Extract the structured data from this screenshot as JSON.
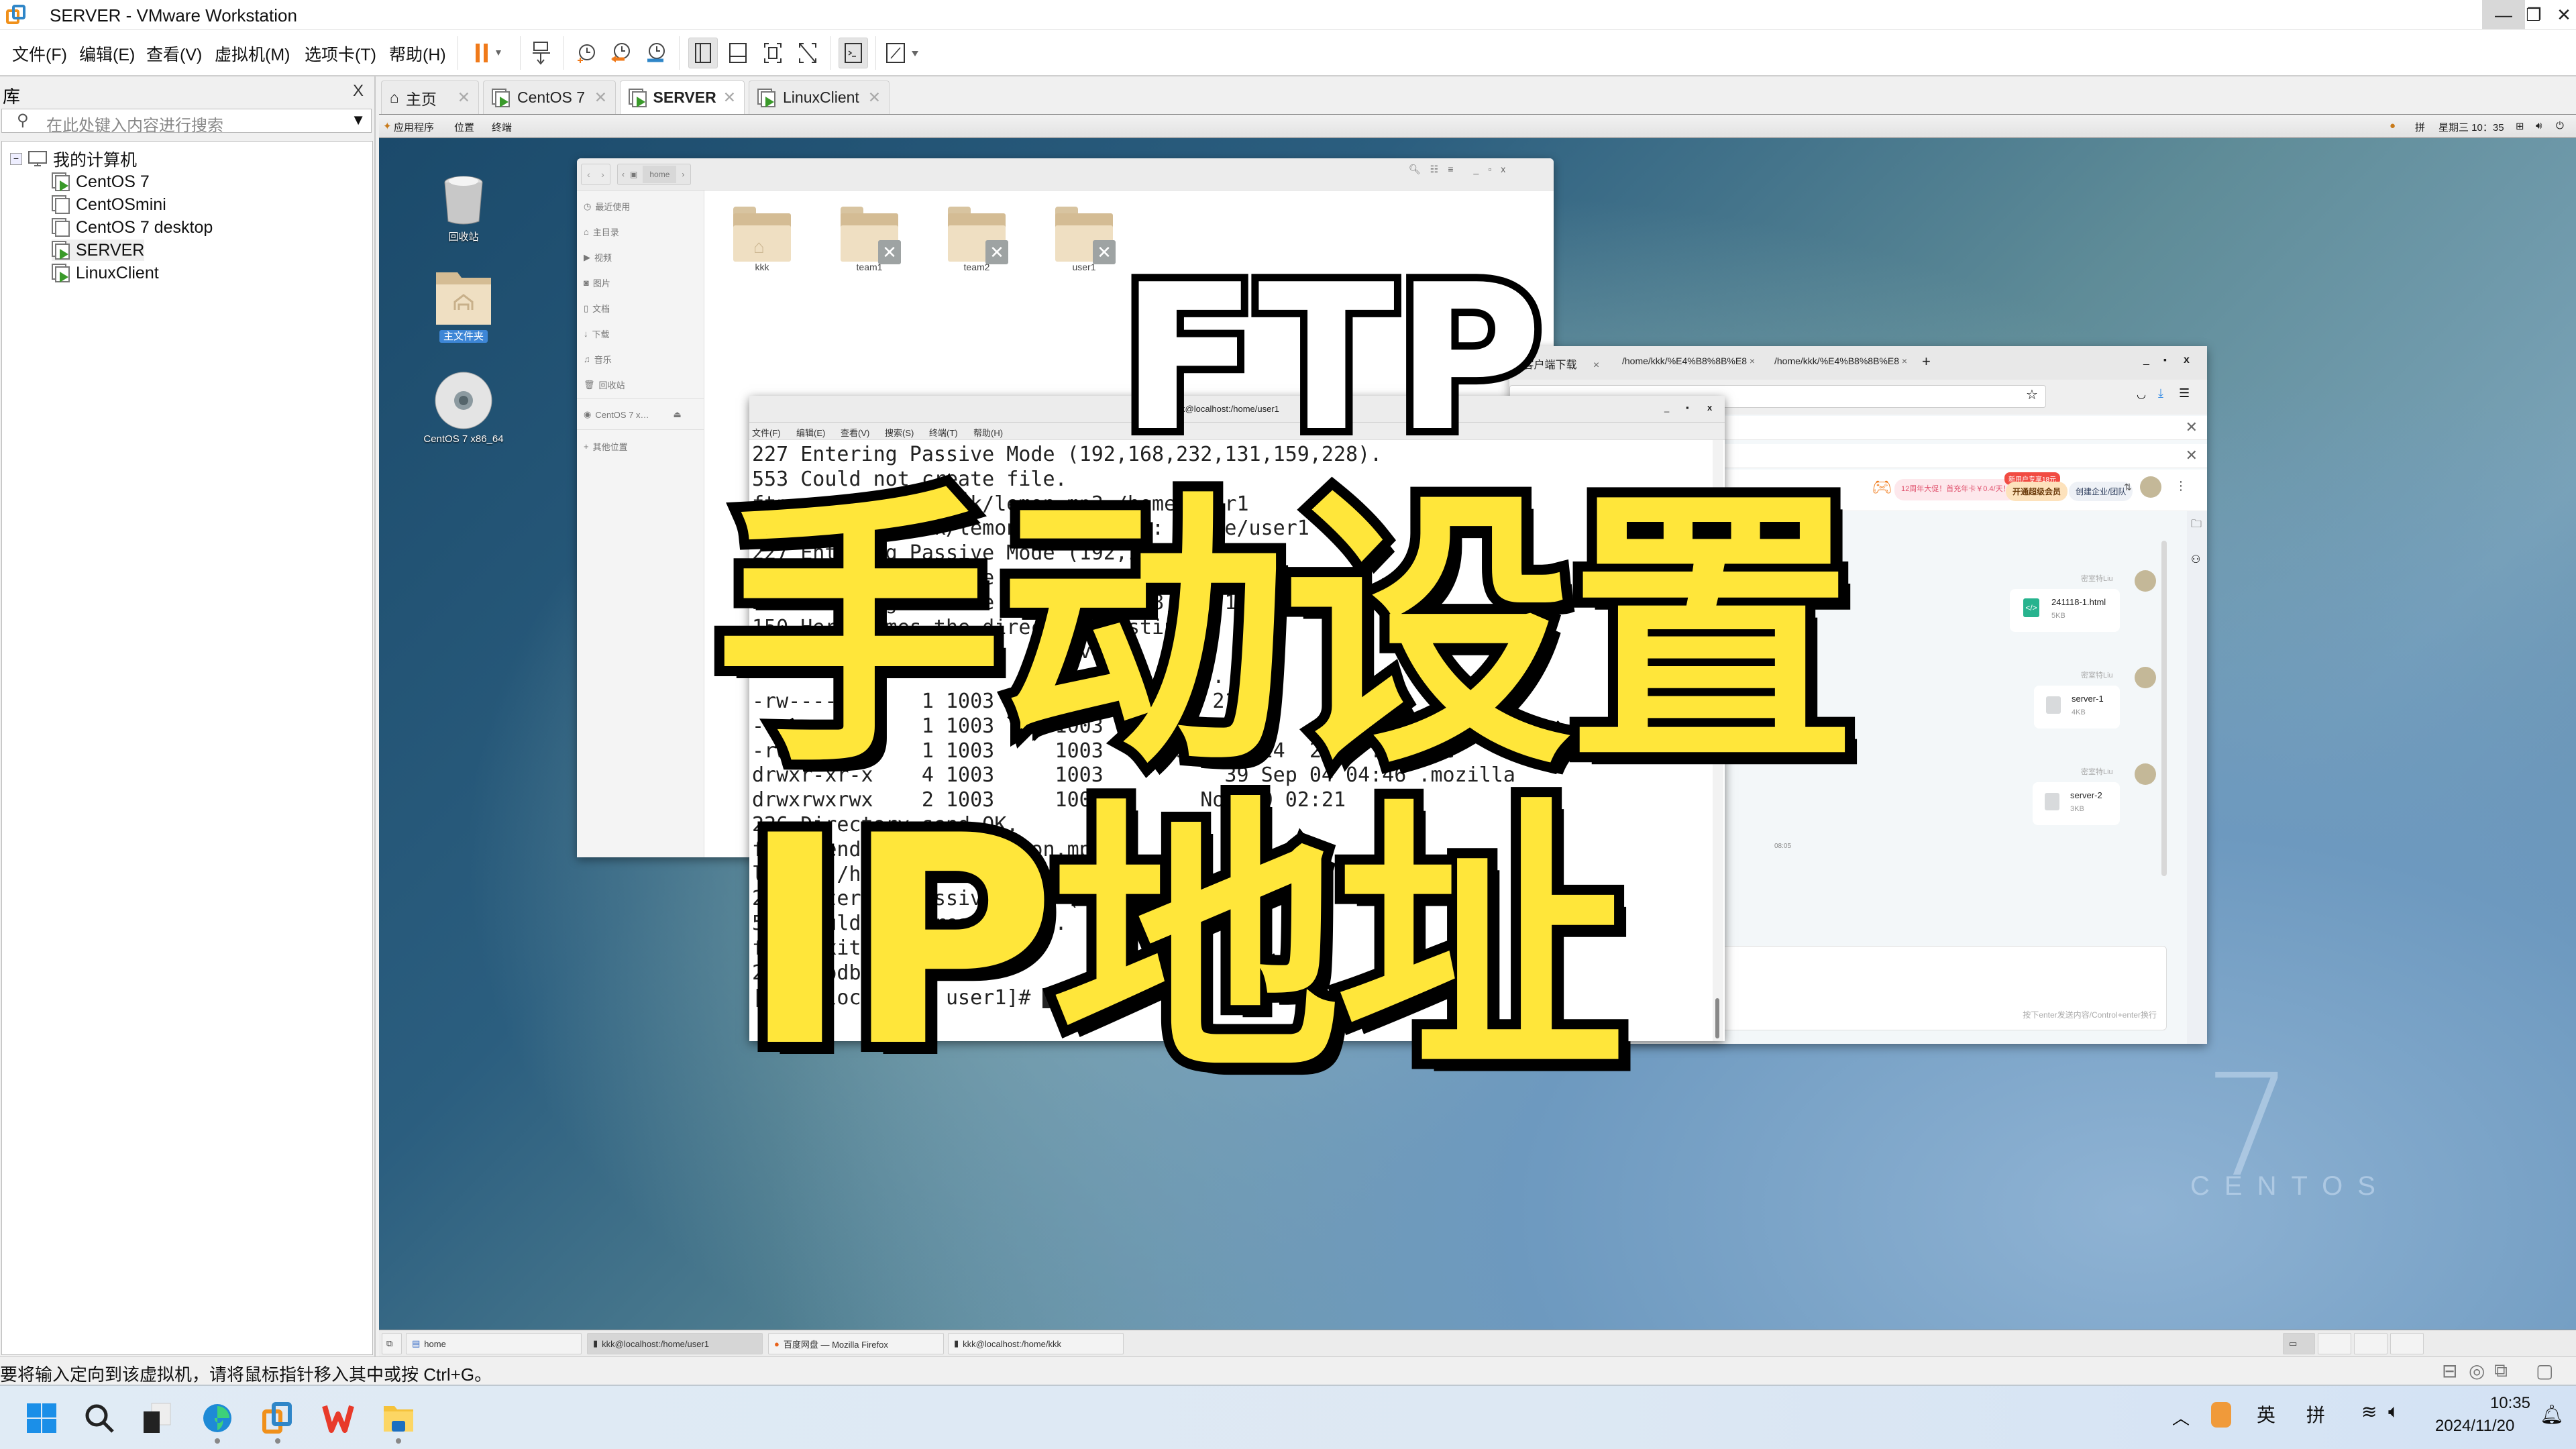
{
  "window": {
    "title": "SERVER - VMware Workstation",
    "controls": {
      "minimize": "—",
      "maximize": "❐",
      "close": "✕"
    }
  },
  "menubar": {
    "items": [
      "文件(F)",
      "编辑(E)",
      "查看(V)",
      "虚拟机(M)",
      "选项卡(T)",
      "帮助(H)"
    ],
    "toolbar_icons": [
      "pause-icon",
      "send-ctrl-alt-del-icon",
      "snapshot-take-icon",
      "snapshot-revert-icon",
      "snapshot-manager-icon",
      "library-view-icon",
      "thumbnail-view-icon",
      "fullscreen-icon",
      "unity-icon",
      "console-view-icon",
      "stretch-view-icon"
    ]
  },
  "library": {
    "title": "库",
    "close": "X",
    "search_placeholder": "在此处键入内容进行搜索",
    "root": "我的计算机",
    "vms": [
      {
        "name": "CentOS 7",
        "running": true
      },
      {
        "name": "CentOSmini",
        "running": false
      },
      {
        "name": "CentOS 7 desktop",
        "running": false
      },
      {
        "name": "SERVER",
        "running": true,
        "selected": true
      },
      {
        "name": "LinuxClient",
        "running": true
      }
    ]
  },
  "vm_tabs": [
    {
      "label": "主页",
      "active": false
    },
    {
      "label": "CentOS 7",
      "active": false
    },
    {
      "label": "SERVER",
      "active": true
    },
    {
      "label": "LinuxClient",
      "active": false
    }
  ],
  "gnome_bar": {
    "menus": [
      "应用程序",
      "位置",
      "终端"
    ],
    "ime": "拼",
    "clock": "星期三 10：35"
  },
  "desktop": {
    "icons": [
      {
        "label": "回收站",
        "icon": "trash-icon"
      },
      {
        "label": "主文件夹",
        "icon": "home-folder-icon",
        "selected": true
      },
      {
        "label": "CentOS 7 x86_64",
        "icon": "disc-icon"
      }
    ],
    "wallpaper_logo": {
      "number": "7",
      "text": "CENTOS"
    }
  },
  "file_manager": {
    "path": "home",
    "sidebar": [
      "最近使用",
      "主目录",
      "视频",
      "图片",
      "文档",
      "下载",
      "音乐",
      "回收站",
      "CentOS 7 x…",
      "其他位置"
    ],
    "folders": [
      {
        "name": "kkk",
        "locked": false
      },
      {
        "name": "team1",
        "locked": true
      },
      {
        "name": "team2",
        "locked": true
      },
      {
        "name": "user1",
        "locked": true
      }
    ]
  },
  "firefox": {
    "tabs": [
      "盘 客户端下载",
      "/home/kkk/%E4%B8%8B%E8",
      "/home/kkk/%E4%B8%8B%E8"
    ],
    "new_tab": "+",
    "promo": "12周年大促！首充年卡￥0.4/天！",
    "vip_badge": "新用户专享18元",
    "vip_button": "开通超级会员",
    "team_button": "创建企业/团队",
    "chat": {
      "messages": [
        {
          "sender": "密室特Liu",
          "file": "241118-1.html",
          "size": "5KB",
          "type": "html"
        },
        {
          "sender": "密室特Liu",
          "file": "server-1",
          "size": "4KB",
          "type": "generic"
        },
        {
          "sender": "密室特Liu",
          "file": "server-2",
          "size": "3KB",
          "type": "generic"
        }
      ],
      "timestamp": "08:05",
      "input_hint": "按下enter发送内容/Control+enter换行"
    }
  },
  "terminal": {
    "title": "kkk@localhost:/home/user1",
    "menu": [
      "文件(F)",
      "编辑(E)",
      "查看(V)",
      "搜索(S)",
      "终端(T)",
      "帮助(H)"
    ],
    "lines": [
      "227 Entering Passive Mode (192,168,232,131,159,228).",
      "553 Could not create file.",
      "ftp> send /home/kkk/lemon.mp3 /home/user1",
      "local: /home/kkk/lemon.mp3 remote: /home/user1",
      "227 Entering Passive Mode (192,168,232,131,8",
      "553 Could not create file.",
      "",
      "227 Entering Passive Mode (192,168,232,131,5",
      "150 Here comes the directory listing.",
      "                         Nov        1",
      "                         Nov        0 .",
      "-rw-------    1 1003     1003     Nov 21        ut",
      "-rw-r--r--    1 1003     1003     Nov 20        n_",
      "-rw-r--r--    1 1003     1003     231 Nov 24  2021 .bashrc",
      "drwxr-xr-x    4 1003     1003          39 Sep 04 04:46 .mozilla",
      "drwxrwxrwx    2 1003     1003        Nov 20 02:21",
      "226 Directory send OK.",
      "ftp> send /home/kkk/lemon.mp3",
      "local: /home/kkk/lemon.mp3 remote",
      "227 Entering Passive Mode (192,",
      "553 Could not create file.",
      "ftp> exit",
      "221 Goodbye.",
      "[root@localhost user1]# "
    ]
  },
  "overlay": {
    "line0": "FTP",
    "line1": "手动设置",
    "line2": "IP地址"
  },
  "guest_taskbar": {
    "items": [
      {
        "label": "home",
        "icon": "file-manager-icon",
        "active": false
      },
      {
        "label": "kkk@localhost:/home/user1",
        "icon": "terminal-icon",
        "active": true
      },
      {
        "label": "百度网盘 — Mozilla Firefox",
        "icon": "firefox-icon",
        "active": false
      },
      {
        "label": "kkk@localhost:/home/kkk",
        "icon": "terminal-icon",
        "active": false
      }
    ]
  },
  "statusbar": {
    "message": "要将输入定向到该虚拟机，请将鼠标指针移入其中或按 Ctrl+G。"
  },
  "win_taskbar": {
    "apps": [
      "start-icon",
      "search-icon",
      "task-view-icon",
      "edge-icon",
      "vmware-icon",
      "wps-icon",
      "file-explorer-icon"
    ],
    "tray": {
      "ime1": "英",
      "ime2": "拼",
      "time": "10:35",
      "date": "2024/11/20"
    }
  }
}
